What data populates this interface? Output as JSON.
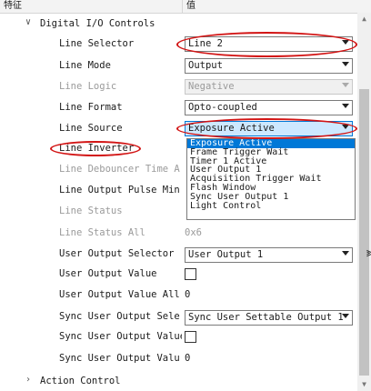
{
  "header": {
    "col_feature": "特征",
    "col_value": "值"
  },
  "category": {
    "label": "Digital I/O Controls"
  },
  "rows": [
    {
      "label": "Line Selector",
      "value": "Line 2"
    },
    {
      "label": "Line Mode",
      "value": "Output"
    },
    {
      "label": "Line Logic",
      "value": "Negative"
    },
    {
      "label": "Line Format",
      "value": "Opto-coupled"
    },
    {
      "label": "Line Source",
      "value": "Exposure Active"
    },
    {
      "label": "Line Inverter"
    },
    {
      "label": "Line Debouncer Time A..."
    },
    {
      "label": "Line Output Pulse Min..."
    },
    {
      "label": "Line Status"
    },
    {
      "label": "Line Status All",
      "value": "0x6"
    },
    {
      "label": "User Output Selector",
      "value": "User Output 1"
    },
    {
      "label": "User Output Value"
    },
    {
      "label": "User Output Value All",
      "value": "0"
    },
    {
      "label": "Sync User Output Sele...",
      "value": "Sync User Settable Output 1"
    },
    {
      "label": "Sync User Output Value"
    },
    {
      "label": "Sync User Output Valu...",
      "value": "0"
    }
  ],
  "dropdown": {
    "options": [
      "Exposure Active",
      "Frame Trigger Wait",
      "Timer 1 Active",
      "User Output 1",
      "Acquisition Trigger Wait",
      "Flash Window",
      "Sync User Output 1",
      "Light Control"
    ],
    "selected": "Exposure Active"
  },
  "next_category": {
    "label": "Action Control"
  },
  "colors": {
    "selection": "#0078d7",
    "annotation": "#d21414"
  }
}
